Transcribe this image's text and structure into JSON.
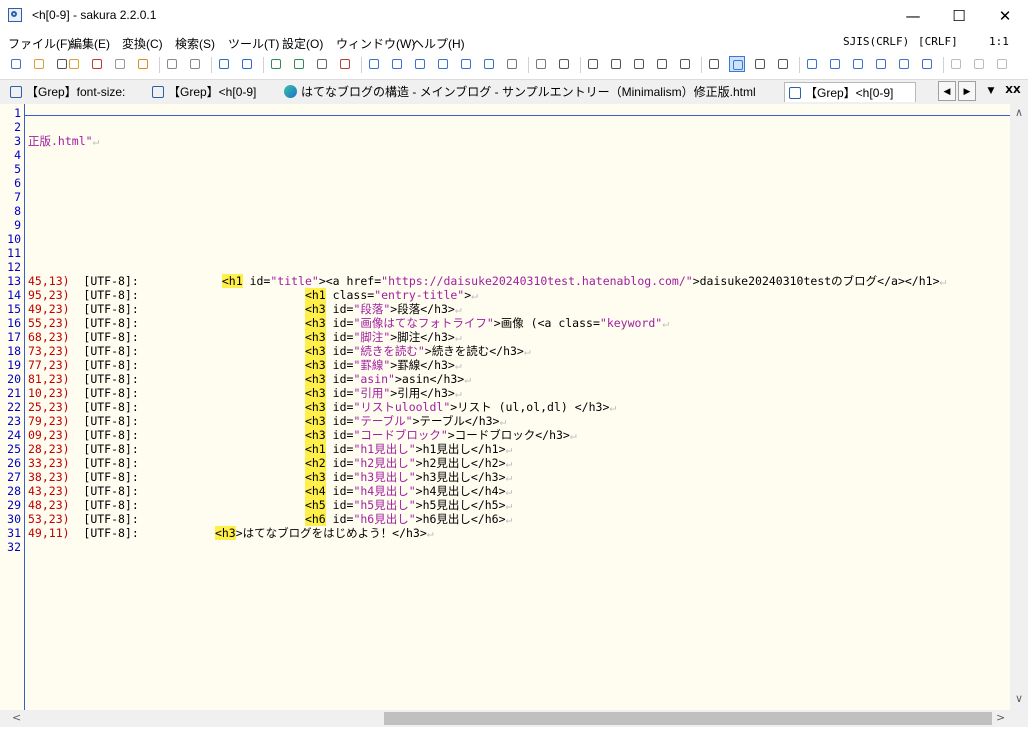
{
  "window": {
    "title": "<h[0-9] - sakura 2.2.0.1",
    "controls": {
      "minimize": "—",
      "maximize": "☐",
      "close": "✕"
    }
  },
  "menu": {
    "items": [
      "ファイル(F)",
      "編集(E)",
      "変換(C)",
      "検索(S)",
      "ツール(T)",
      "設定(O)",
      "ウィンドウ(W)",
      "ヘルプ(H)"
    ],
    "status": {
      "encoding": "SJIS(CRLF)",
      "eol": "[CRLF]",
      "position": "1:1"
    }
  },
  "toolbar": {
    "icons": [
      "new-file-icon",
      "open-folder-icon",
      "dropdown-arrow-icon",
      "open-recent-icon",
      "close-file-icon",
      "save-gray-icon",
      "save-icon",
      "undo-icon",
      "redo-icon",
      "move-prev-icon",
      "move-next-icon",
      "grep-icon",
      "grep-replace-icon",
      "copy-path-icon",
      "hand-icon",
      "find-icon",
      "find-prev-icon",
      "find-next-icon",
      "find-all-icon",
      "find-replace-icon",
      "find-clear-icon",
      "jump-icon",
      "compare-icon",
      "print-preview-icon",
      "window-list-icon",
      "tile-h-icon",
      "tile-v-icon",
      "settings-icon",
      "outline-icon",
      "font-icon",
      "view-mode-icon",
      "keyboard-icon",
      "tab-mode-icon",
      "macro-19-icon",
      "macro-9-icon",
      "macro-11-icon",
      "macro-10-icon",
      "macro-12-icon",
      "macro-13-icon",
      "abc-icon",
      "c-icon",
      "misc-icon"
    ]
  },
  "tabs": [
    {
      "label": "【Grep】font-size:",
      "icon": "sakura"
    },
    {
      "label": "【Grep】<h[0-9]",
      "icon": "sakura"
    },
    {
      "label": "はてなブログの構造 - メインブログ - サンプルエントリー（Minimalism）修正版.html",
      "icon": "edge"
    },
    {
      "label": "【Grep】<h[0-9]",
      "icon": "sakura",
      "active": true
    }
  ],
  "tabnav": {
    "prev": "◀",
    "next": "▶",
    "list": "▼",
    "close": "XX"
  },
  "editor": {
    "lines": [
      {
        "n": "1",
        "segs": []
      },
      {
        "n": "2",
        "segs": []
      },
      {
        "n": "3",
        "segs": [
          {
            "t": "正版.html\"",
            "c": "str"
          },
          {
            "t": "↵",
            "c": "crlf"
          }
        ]
      },
      {
        "n": "4",
        "segs": []
      },
      {
        "n": "5",
        "segs": []
      },
      {
        "n": "6",
        "segs": []
      },
      {
        "n": "7",
        "segs": []
      },
      {
        "n": "8",
        "segs": []
      },
      {
        "n": "9",
        "segs": []
      },
      {
        "n": "10",
        "segs": []
      },
      {
        "n": "11",
        "segs": []
      },
      {
        "n": "12",
        "segs": []
      },
      {
        "n": "13",
        "segs": [
          {
            "t": "45,13)",
            "c": "pos"
          },
          {
            "t": "  [UTF-8]:            ",
            "c": "attr"
          },
          {
            "t": "<h1",
            "c": "kw"
          },
          {
            "t": " id=",
            "c": "attr"
          },
          {
            "t": "\"title\"",
            "c": "str"
          },
          {
            "t": "><a href=",
            "c": "attr"
          },
          {
            "t": "\"https://daisuke20240310test.hatenablog.com/\"",
            "c": "str"
          },
          {
            "t": ">daisuke20240310testのブログ</a></h1>",
            "c": "attr"
          },
          {
            "t": "↵",
            "c": "crlf"
          }
        ]
      },
      {
        "n": "14",
        "segs": [
          {
            "t": "95,23)",
            "c": "pos"
          },
          {
            "t": "  [UTF-8]:                        ",
            "c": "attr"
          },
          {
            "t": "<h1",
            "c": "kw"
          },
          {
            "t": " class=",
            "c": "attr"
          },
          {
            "t": "\"entry-title\"",
            "c": "str"
          },
          {
            "t": ">",
            "c": "attr"
          },
          {
            "t": "↵",
            "c": "crlf"
          }
        ]
      },
      {
        "n": "15",
        "segs": [
          {
            "t": "49,23)",
            "c": "pos"
          },
          {
            "t": "  [UTF-8]:                        ",
            "c": "attr"
          },
          {
            "t": "<h3",
            "c": "kw"
          },
          {
            "t": " id=",
            "c": "attr"
          },
          {
            "t": "\"段落\"",
            "c": "str"
          },
          {
            "t": ">段落</h3>",
            "c": "attr"
          },
          {
            "t": "↵",
            "c": "crlf"
          }
        ]
      },
      {
        "n": "16",
        "segs": [
          {
            "t": "55,23)",
            "c": "pos"
          },
          {
            "t": "  [UTF-8]:                        ",
            "c": "attr"
          },
          {
            "t": "<h3",
            "c": "kw"
          },
          {
            "t": " id=",
            "c": "attr"
          },
          {
            "t": "\"画像はてなフォトライフ\"",
            "c": "str"
          },
          {
            "t": ">画像 (<a class=",
            "c": "attr"
          },
          {
            "t": "\"keyword\"",
            "c": "str"
          },
          {
            "t": "↵",
            "c": "crlf"
          }
        ]
      },
      {
        "n": "17",
        "segs": [
          {
            "t": "68,23)",
            "c": "pos"
          },
          {
            "t": "  [UTF-8]:                        ",
            "c": "attr"
          },
          {
            "t": "<h3",
            "c": "kw"
          },
          {
            "t": " id=",
            "c": "attr"
          },
          {
            "t": "\"脚注\"",
            "c": "str"
          },
          {
            "t": ">脚注</h3>",
            "c": "attr"
          },
          {
            "t": "↵",
            "c": "crlf"
          }
        ]
      },
      {
        "n": "18",
        "segs": [
          {
            "t": "73,23)",
            "c": "pos"
          },
          {
            "t": "  [UTF-8]:                        ",
            "c": "attr"
          },
          {
            "t": "<h3",
            "c": "kw"
          },
          {
            "t": " id=",
            "c": "attr"
          },
          {
            "t": "\"続きを読む\"",
            "c": "str"
          },
          {
            "t": ">続きを読む</h3>",
            "c": "attr"
          },
          {
            "t": "↵",
            "c": "crlf"
          }
        ]
      },
      {
        "n": "19",
        "segs": [
          {
            "t": "77,23)",
            "c": "pos"
          },
          {
            "t": "  [UTF-8]:                        ",
            "c": "attr"
          },
          {
            "t": "<h3",
            "c": "kw"
          },
          {
            "t": " id=",
            "c": "attr"
          },
          {
            "t": "\"罫線\"",
            "c": "str"
          },
          {
            "t": ">罫線</h3>",
            "c": "attr"
          },
          {
            "t": "↵",
            "c": "crlf"
          }
        ]
      },
      {
        "n": "20",
        "segs": [
          {
            "t": "81,23)",
            "c": "pos"
          },
          {
            "t": "  [UTF-8]:                        ",
            "c": "attr"
          },
          {
            "t": "<h3",
            "c": "kw"
          },
          {
            "t": " id=",
            "c": "attr"
          },
          {
            "t": "\"asin\"",
            "c": "str"
          },
          {
            "t": ">asin</h3>",
            "c": "attr"
          },
          {
            "t": "↵",
            "c": "crlf"
          }
        ]
      },
      {
        "n": "21",
        "segs": [
          {
            "t": "10,23)",
            "c": "pos"
          },
          {
            "t": "  [UTF-8]:                        ",
            "c": "attr"
          },
          {
            "t": "<h3",
            "c": "kw"
          },
          {
            "t": " id=",
            "c": "attr"
          },
          {
            "t": "\"引用\"",
            "c": "str"
          },
          {
            "t": ">引用</h3>",
            "c": "attr"
          },
          {
            "t": "↵",
            "c": "crlf"
          }
        ]
      },
      {
        "n": "22",
        "segs": [
          {
            "t": "25,23)",
            "c": "pos"
          },
          {
            "t": "  [UTF-8]:                        ",
            "c": "attr"
          },
          {
            "t": "<h3",
            "c": "kw"
          },
          {
            "t": " id=",
            "c": "attr"
          },
          {
            "t": "\"リストulooldl\"",
            "c": "str"
          },
          {
            "t": ">リスト (ul,ol,dl) </h3>",
            "c": "attr"
          },
          {
            "t": "↵",
            "c": "crlf"
          }
        ]
      },
      {
        "n": "23",
        "segs": [
          {
            "t": "79,23)",
            "c": "pos"
          },
          {
            "t": "  [UTF-8]:                        ",
            "c": "attr"
          },
          {
            "t": "<h3",
            "c": "kw"
          },
          {
            "t": " id=",
            "c": "attr"
          },
          {
            "t": "\"テーブル\"",
            "c": "str"
          },
          {
            "t": ">テーブル</h3>",
            "c": "attr"
          },
          {
            "t": "↵",
            "c": "crlf"
          }
        ]
      },
      {
        "n": "24",
        "segs": [
          {
            "t": "09,23)",
            "c": "pos"
          },
          {
            "t": "  [UTF-8]:                        ",
            "c": "attr"
          },
          {
            "t": "<h3",
            "c": "kw"
          },
          {
            "t": " id=",
            "c": "attr"
          },
          {
            "t": "\"コードブロック\"",
            "c": "str"
          },
          {
            "t": ">コードブロック</h3>",
            "c": "attr"
          },
          {
            "t": "↵",
            "c": "crlf"
          }
        ]
      },
      {
        "n": "25",
        "segs": [
          {
            "t": "28,23)",
            "c": "pos"
          },
          {
            "t": "  [UTF-8]:                        ",
            "c": "attr"
          },
          {
            "t": "<h1",
            "c": "kw"
          },
          {
            "t": " id=",
            "c": "attr"
          },
          {
            "t": "\"h1見出し\"",
            "c": "str"
          },
          {
            "t": ">h1見出し</h1>",
            "c": "attr"
          },
          {
            "t": "↵",
            "c": "crlf"
          }
        ]
      },
      {
        "n": "26",
        "segs": [
          {
            "t": "33,23)",
            "c": "pos"
          },
          {
            "t": "  [UTF-8]:                        ",
            "c": "attr"
          },
          {
            "t": "<h2",
            "c": "kw"
          },
          {
            "t": " id=",
            "c": "attr"
          },
          {
            "t": "\"h2見出し\"",
            "c": "str"
          },
          {
            "t": ">h2見出し</h2>",
            "c": "attr"
          },
          {
            "t": "↵",
            "c": "crlf"
          }
        ]
      },
      {
        "n": "27",
        "segs": [
          {
            "t": "38,23)",
            "c": "pos"
          },
          {
            "t": "  [UTF-8]:                        ",
            "c": "attr"
          },
          {
            "t": "<h3",
            "c": "kw"
          },
          {
            "t": " id=",
            "c": "attr"
          },
          {
            "t": "\"h3見出し\"",
            "c": "str"
          },
          {
            "t": ">h3見出し</h3>",
            "c": "attr"
          },
          {
            "t": "↵",
            "c": "crlf"
          }
        ]
      },
      {
        "n": "28",
        "segs": [
          {
            "t": "43,23)",
            "c": "pos"
          },
          {
            "t": "  [UTF-8]:                        ",
            "c": "attr"
          },
          {
            "t": "<h4",
            "c": "kw"
          },
          {
            "t": " id=",
            "c": "attr"
          },
          {
            "t": "\"h4見出し\"",
            "c": "str"
          },
          {
            "t": ">h4見出し</h4>",
            "c": "attr"
          },
          {
            "t": "↵",
            "c": "crlf"
          }
        ]
      },
      {
        "n": "29",
        "segs": [
          {
            "t": "48,23)",
            "c": "pos"
          },
          {
            "t": "  [UTF-8]:                        ",
            "c": "attr"
          },
          {
            "t": "<h5",
            "c": "kw"
          },
          {
            "t": " id=",
            "c": "attr"
          },
          {
            "t": "\"h5見出し\"",
            "c": "str"
          },
          {
            "t": ">h5見出し</h5>",
            "c": "attr"
          },
          {
            "t": "↵",
            "c": "crlf"
          }
        ]
      },
      {
        "n": "30",
        "segs": [
          {
            "t": "53,23)",
            "c": "pos"
          },
          {
            "t": "  [UTF-8]:                        ",
            "c": "attr"
          },
          {
            "t": "<h6",
            "c": "kw"
          },
          {
            "t": " id=",
            "c": "attr"
          },
          {
            "t": "\"h6見出し\"",
            "c": "str"
          },
          {
            "t": ">h6見出し</h6>",
            "c": "attr"
          },
          {
            "t": "↵",
            "c": "crlf"
          }
        ]
      },
      {
        "n": "31",
        "segs": [
          {
            "t": "49,11)",
            "c": "pos"
          },
          {
            "t": "  [UTF-8]:           ",
            "c": "attr"
          },
          {
            "t": "<h3",
            "c": "kw"
          },
          {
            "t": ">はてなブログをはじめよう！</h3>",
            "c": "attr"
          },
          {
            "t": "↵",
            "c": "crlf"
          }
        ]
      },
      {
        "n": "32",
        "segs": []
      }
    ]
  },
  "scrollbar": {
    "up": "∧",
    "down": "∨",
    "left": "<",
    "right": ">"
  }
}
